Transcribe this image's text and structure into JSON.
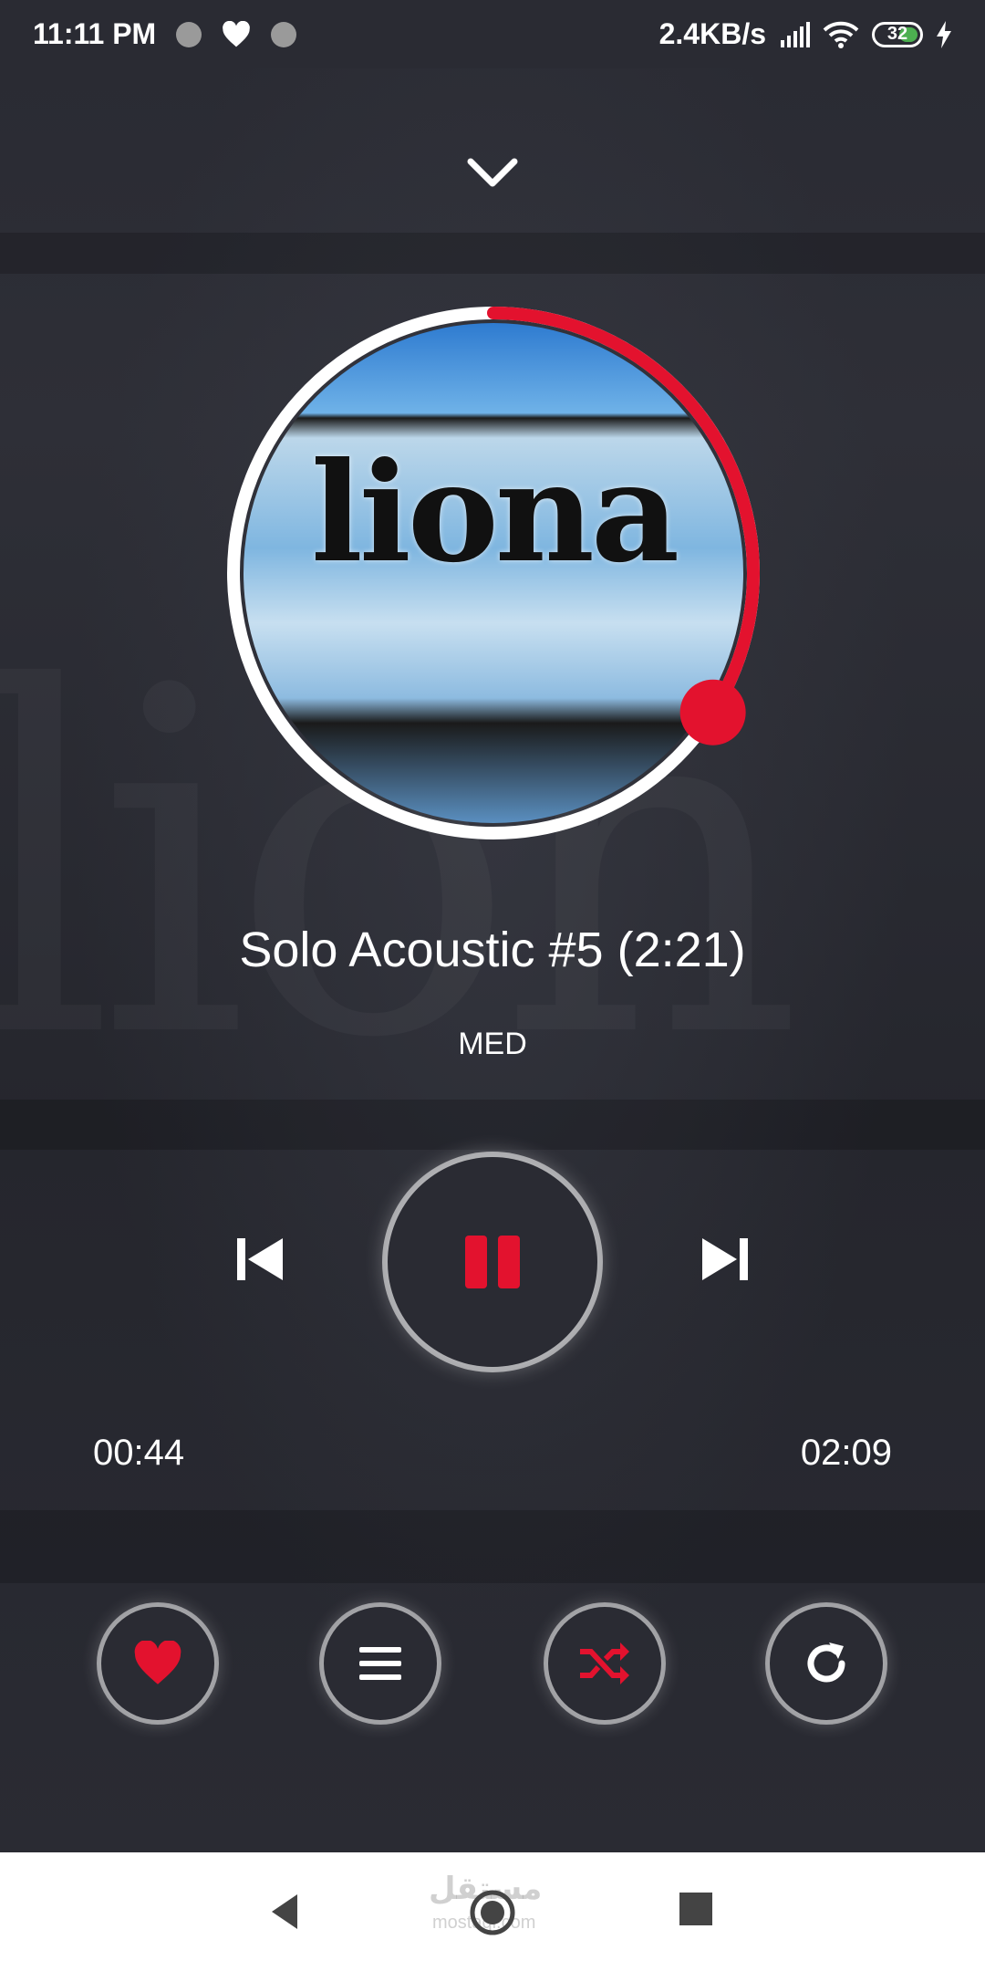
{
  "status_bar": {
    "time": "11:11 PM",
    "net_speed": "2.4KB/s",
    "battery": "32"
  },
  "background": {
    "art_text": "lion"
  },
  "album": {
    "art_text": "liona"
  },
  "track": {
    "title": "Solo Acoustic #5 (2:21)",
    "artist": "MED",
    "current_time": "00:44",
    "duration": "02:09",
    "progress_fraction": 0.34
  },
  "nav": {
    "watermark": "مستقل",
    "watermark_sub": "mostaql.com"
  },
  "colors": {
    "accent": "#e3122e",
    "background": "#2a2b33"
  },
  "icons": {
    "collapse": "chevron-down-icon",
    "prev": "skip-previous-icon",
    "play_pause": "pause-icon",
    "next": "skip-next-icon",
    "favorite": "heart-icon",
    "playlist": "menu-icon",
    "shuffle": "shuffle-icon",
    "repeat": "repeat-icon"
  }
}
